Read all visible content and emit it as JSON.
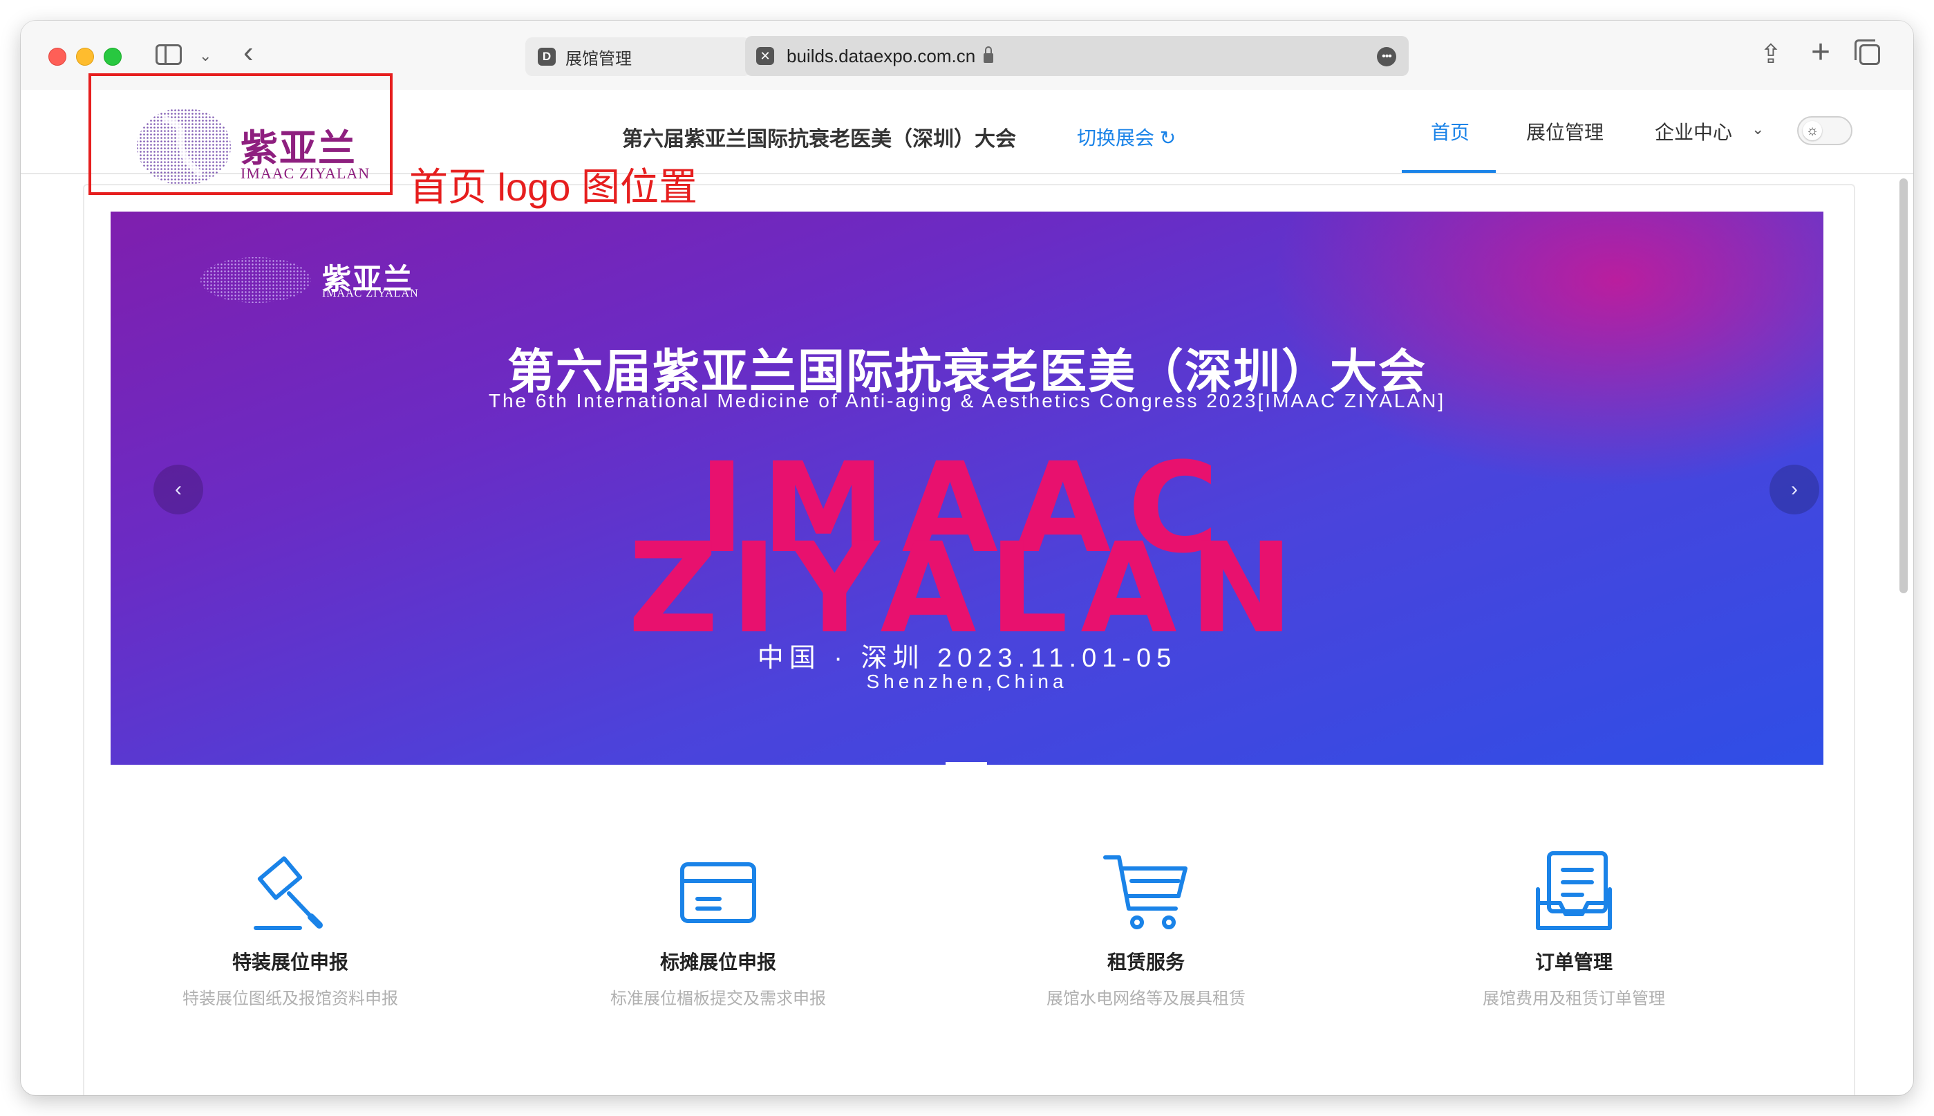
{
  "browser": {
    "tab_favicon_letter": "D",
    "tab_title": "展馆管理",
    "url_favicon": "✕",
    "url": "builds.dataexpo.com.cn"
  },
  "header": {
    "logo_cn": "紫亚兰",
    "logo_en": "IMAAC ZIYALAN",
    "annotation": "首页 logo 图位置",
    "site_title": "第六届紫亚兰国际抗衰老医美（深圳）大会",
    "switch_link": "切换展会",
    "nav": {
      "home": "首页",
      "booth": "展位管理",
      "enterprise": "企业中心"
    }
  },
  "banner": {
    "logo_cn": "紫亚兰",
    "logo_en": "IMAAC ZIYALAN",
    "title": "第六届紫亚兰国际抗衰老医美（深圳）大会",
    "subtitle": "The 6th International Medicine of Anti-aging & Aesthetics Congress 2023[IMAAC ZIYALAN]",
    "brand_line1": "IMAAC",
    "brand_line2": "ZIYALAN",
    "date": "中国 · 深圳  2023.11.01-05",
    "city": "Shenzhen,China",
    "prev": "‹",
    "next": "›"
  },
  "features": [
    {
      "icon": "hammer-icon",
      "title": "特装展位申报",
      "desc": "特装展位图纸及报馆资料申报"
    },
    {
      "icon": "card-icon",
      "title": "标摊展位申报",
      "desc": "标准展位楣板提交及需求申报"
    },
    {
      "icon": "cart-icon",
      "title": "租赁服务",
      "desc": "展馆水电网络等及展具租赁"
    },
    {
      "icon": "order-icon",
      "title": "订单管理",
      "desc": "展馆费用及租赁订单管理"
    }
  ],
  "colors": {
    "accent": "#1a83e8",
    "logo": "#8e1f7f",
    "brand_pink": "#e8116e",
    "annotation": "#e61e1e"
  }
}
